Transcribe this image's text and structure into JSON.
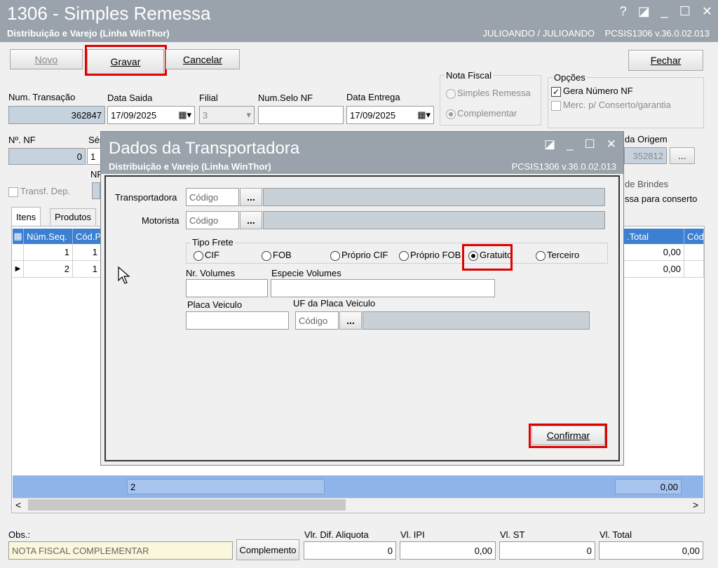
{
  "window": {
    "title": "1306 - Simples Remessa",
    "subtitle": "Distribuição e Varejo (Linha WinThor)",
    "user_info": "JULIOANDO / JULIOANDO",
    "version": "PCSIS1306  v.36.0.02.013",
    "controls": [
      "?",
      "◪",
      "_",
      "☐",
      "✕"
    ]
  },
  "toolbar": {
    "novo": "Novo",
    "gravar": "Gravar",
    "cancelar": "Cancelar",
    "fechar": "Fechar"
  },
  "fields": {
    "num_transacao_label": "Num. Transação",
    "num_transacao": "362847",
    "data_saida_label": "Data Saida",
    "data_saida": "17/09/2025",
    "filial_label": "Filial",
    "filial": "3",
    "num_selo_label": "Num.Selo NF",
    "num_selo": "",
    "data_entrega_label": "Data Entrega",
    "data_entrega": "17/09/2025",
    "nf_label": "Nº. NF",
    "nf": "0",
    "serie_label": "Sér",
    "serie": "1",
    "nf2_label": "NF",
    "origem_label": "da Origem",
    "origem": "352812",
    "transf_dep": "Transf. Dep.",
    "brindes": "de Brindes",
    "conserto": "ssa para conserto"
  },
  "nota_fiscal": {
    "label": "Nota Fiscal",
    "opt1": "Simples Remessa",
    "opt2": "Complementar"
  },
  "opcoes": {
    "label": "Opções",
    "opt1": "Gera Número NF",
    "opt1_check": "✓",
    "opt2": "Merc. p/ Conserto/garantia"
  },
  "tabs": [
    "Itens",
    "Produtos"
  ],
  "grid": {
    "headers": {
      "seq": "Núm.Seq.",
      "cod": "Cód.P",
      "total": ".Total",
      "cod2": "Cód"
    },
    "rows": [
      {
        "seq": "1",
        "cod": "1",
        "total": "0,00"
      },
      {
        "seq": "2",
        "cod": "1",
        "total": "0,00"
      }
    ],
    "footer_count": "2",
    "footer_total": "0,00"
  },
  "bottom": {
    "obs_label": "Obs.:",
    "obs_value": "NOTA FISCAL COMPLEMENTAR",
    "complemento": "Complemento",
    "dif_label": "Vlr. Dif. Aliquota",
    "dif": "0",
    "ipi_label": "Vl. IPI",
    "ipi": "0,00",
    "st_label": "Vl. ST",
    "st": "0",
    "total_label": "Vl. Total",
    "total": "0,00"
  },
  "modal": {
    "title": "Dados da Transportadora",
    "subtitle": "Distribuição e Varejo (Linha WinThor)",
    "version": "PCSIS1306  v.36.0.02.013",
    "controls": [
      "◪",
      "_",
      "☐",
      "✕"
    ],
    "transportadora_label": "Transportadora",
    "motorista_label": "Motorista",
    "codigo_placeholder": "Código",
    "dots": "...",
    "tipo_frete_label": "Tipo Frete",
    "frete_options": [
      "CIF",
      "FOB",
      "Próprio CIF",
      "Próprio FOB",
      "Gratuito",
      "Terceiro"
    ],
    "selected_frete": "Gratuito",
    "nr_volumes_label": "Nr. Volumes",
    "especie_label": "Especie Volumes",
    "placa_label": "Placa Veiculo",
    "uf_placa_label": "UF da Placa Veiculo",
    "confirmar": "Confirmar"
  }
}
